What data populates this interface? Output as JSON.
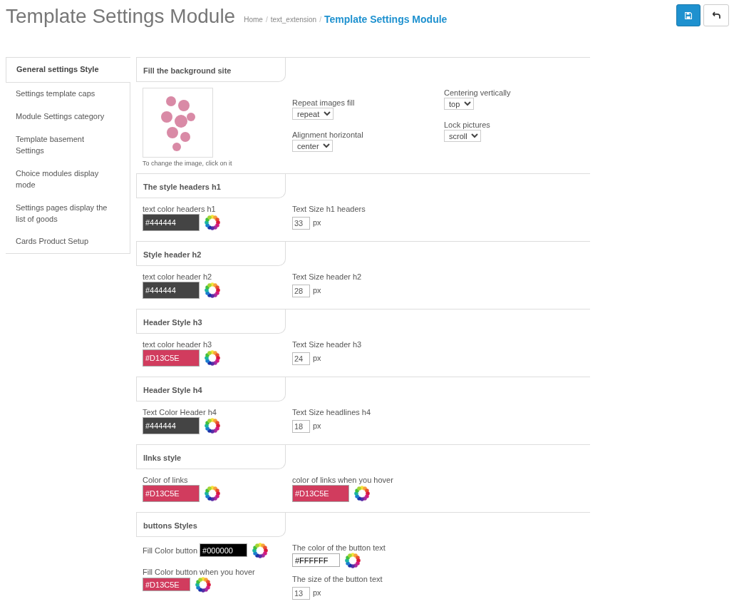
{
  "header": {
    "title": "Template Settings Module",
    "breadcrumb": [
      {
        "label": "Home",
        "active": false
      },
      {
        "separator": "/",
        "label": "text_extension",
        "active": false
      },
      {
        "separator": "/",
        "label": "Template Settings Module",
        "active": true
      }
    ]
  },
  "sidebar": {
    "items": [
      {
        "label": "General settings Style",
        "selected": true
      },
      {
        "label": "Settings template caps",
        "selected": false
      },
      {
        "label": "Module Settings category",
        "selected": false
      },
      {
        "label": "Template basement Settings",
        "selected": false
      },
      {
        "label": "Choice modules display mode",
        "selected": false
      },
      {
        "label": "Settings pages display the list of goods",
        "selected": false
      },
      {
        "label": "Cards Product Setup",
        "selected": false
      }
    ]
  },
  "sections": [
    {
      "title": "Fill the background site",
      "columns": [
        [
          {
            "kind": "image",
            "caption": "To change the image, click on it"
          }
        ],
        [
          {
            "kind": "select",
            "label": "Repeat images fill",
            "value": "repeat"
          },
          {
            "kind": "select",
            "label": "Alignment horizontal",
            "value": "center"
          }
        ],
        [
          {
            "kind": "select",
            "label": "Centering vertically",
            "value": "top"
          },
          {
            "kind": "select",
            "label": "Lock pictures",
            "value": "scroll"
          }
        ]
      ]
    },
    {
      "title": "The style headers h1",
      "columns": [
        [
          {
            "kind": "color",
            "label": "text color headers h1",
            "value": "#444444",
            "color": "#444444"
          }
        ],
        [
          {
            "kind": "size",
            "label": "Text Size h1 headers",
            "value": "33",
            "unit": "px"
          }
        ]
      ]
    },
    {
      "title": "Style header h2",
      "columns": [
        [
          {
            "kind": "color",
            "label": "text color header h2",
            "value": "#444444",
            "color": "#444444"
          }
        ],
        [
          {
            "kind": "size",
            "label": "Text Size header h2",
            "value": "28",
            "unit": "px"
          }
        ]
      ]
    },
    {
      "title": "Header Style h3",
      "columns": [
        [
          {
            "kind": "color",
            "label": "text color header h3",
            "value": "#D13C5E",
            "color": "#d13c5e"
          }
        ],
        [
          {
            "kind": "size",
            "label": "Text Size header h3",
            "value": "24",
            "unit": "px"
          }
        ]
      ]
    },
    {
      "title": "Header Style h4",
      "columns": [
        [
          {
            "kind": "color",
            "label": "Text Color Header h4",
            "value": "#444444",
            "color": "#444444"
          }
        ],
        [
          {
            "kind": "size",
            "label": "Text Size headlines h4",
            "value": "18",
            "unit": "px"
          }
        ]
      ]
    },
    {
      "title": "lInks style",
      "columns": [
        [
          {
            "kind": "color",
            "label": "Color of links",
            "value": "#D13C5E",
            "color": "#d13c5e"
          }
        ],
        [
          {
            "kind": "color",
            "label": "color of links when you hover",
            "value": "#D13C5E",
            "color": "#d13c5e"
          }
        ]
      ]
    },
    {
      "title": "buttons Styles",
      "columns": [
        [
          {
            "kind": "color-inline",
            "label": "Fill Color button",
            "value": "#000000",
            "color": "#000000"
          },
          {
            "kind": "color-small",
            "label": "Fill Color button when you hover",
            "value": "#D13C5E",
            "color": "#d13c5e"
          }
        ],
        [
          {
            "kind": "color-small",
            "label": "The color of the button text",
            "value": "#FFFFFF",
            "color": "#ffffff"
          },
          {
            "kind": "size",
            "label": "The size of the button text",
            "value": "13",
            "unit": "px"
          }
        ]
      ]
    }
  ]
}
